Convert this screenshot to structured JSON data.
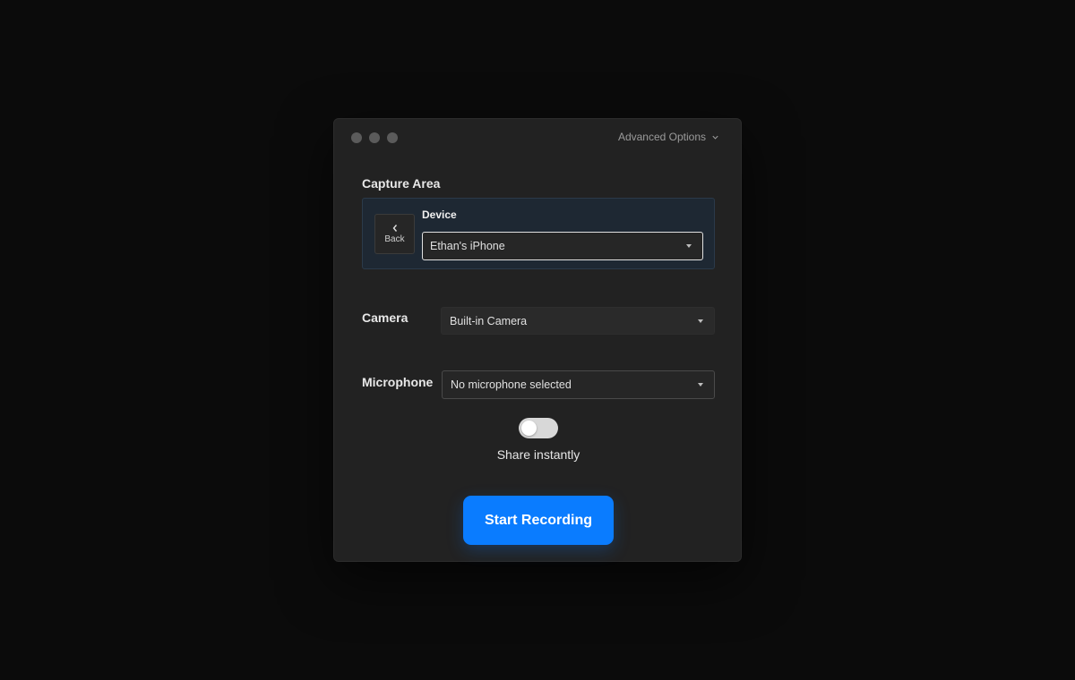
{
  "header": {
    "advanced_options_label": "Advanced Options"
  },
  "capture_area": {
    "title": "Capture Area",
    "back_label": "Back",
    "device_label": "Device",
    "device_value": "Ethan's iPhone"
  },
  "camera": {
    "label": "Camera",
    "value": "Built-in Camera"
  },
  "microphone": {
    "label": "Microphone",
    "value": "No microphone selected"
  },
  "share": {
    "label": "Share instantly",
    "enabled": false
  },
  "actions": {
    "start_label": "Start Recording"
  },
  "colors": {
    "accent": "#0a7cff",
    "window_bg": "#222222",
    "page_bg": "#0b0b0b"
  }
}
